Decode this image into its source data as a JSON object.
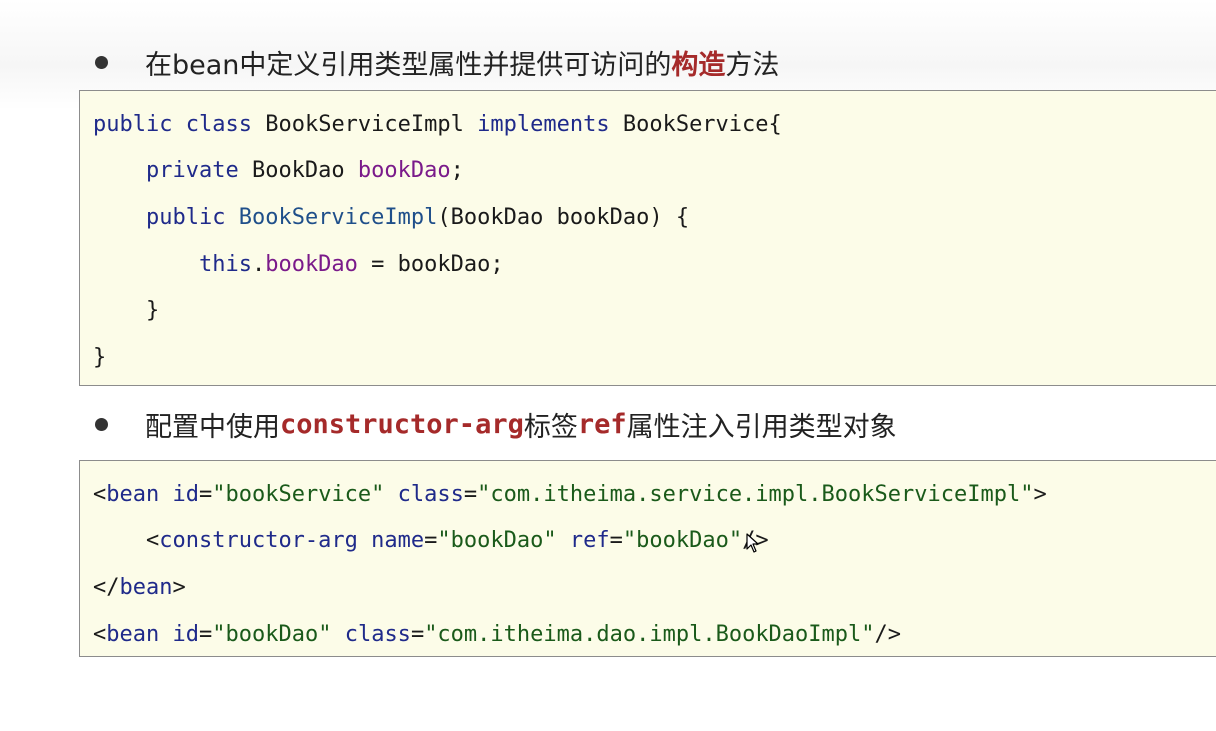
{
  "bullet1": {
    "before": "在bean中定义引用类型属性并提供可访问的",
    "highlight": "构造",
    "after": "方法"
  },
  "code1": {
    "l1": {
      "a": "public",
      "b": " ",
      "c": "class",
      "d": " BookServiceImpl ",
      "e": "implements",
      "f": " BookService{"
    },
    "l2": {
      "a": "    ",
      "b": "private",
      "c": " BookDao ",
      "d": "bookDao",
      "e": ";"
    },
    "l3": {
      "a": "    ",
      "b": "public",
      "c": " ",
      "d": "BookServiceImpl",
      "e": "(BookDao bookDao) {"
    },
    "l4": {
      "a": "        ",
      "b": "this",
      "c": ".",
      "d": "bookDao",
      "e": " = bookDao;"
    },
    "l5": "    }",
    "l6": "}"
  },
  "bullet2": {
    "before": "配置中使用",
    "highlight1": "constructor-arg",
    "middle": "标签",
    "highlight2": "ref",
    "after": "属性注入引用类型对象"
  },
  "code2": {
    "l1": {
      "a": "<",
      "b": "bean",
      "c": " ",
      "d": "id",
      "e": "=",
      "f": "\"bookService\"",
      "g": " ",
      "h": "class",
      "i": "=",
      "j": "\"com.itheima.service.impl.BookServiceImpl\"",
      "k": ">"
    },
    "l2": {
      "a": "    <",
      "b": "constructor-arg",
      "c": " ",
      "d": "name",
      "e": "=",
      "f": "\"bookDao\"",
      "g": " ",
      "h": "ref",
      "i": "=",
      "j": "\"bookDao\"",
      "k": "/>"
    },
    "l3": {
      "a": "</",
      "b": "bean",
      "c": ">"
    },
    "l4": {
      "a": "<",
      "b": "bean",
      "c": " ",
      "d": "id",
      "e": "=",
      "f": "\"bookDao\"",
      "g": " ",
      "h": "class",
      "i": "=",
      "j": "\"com.itheima.dao.impl.BookDaoImpl\"",
      "k": "/>"
    }
  },
  "cursor_icon": "mouse-pointer-icon"
}
